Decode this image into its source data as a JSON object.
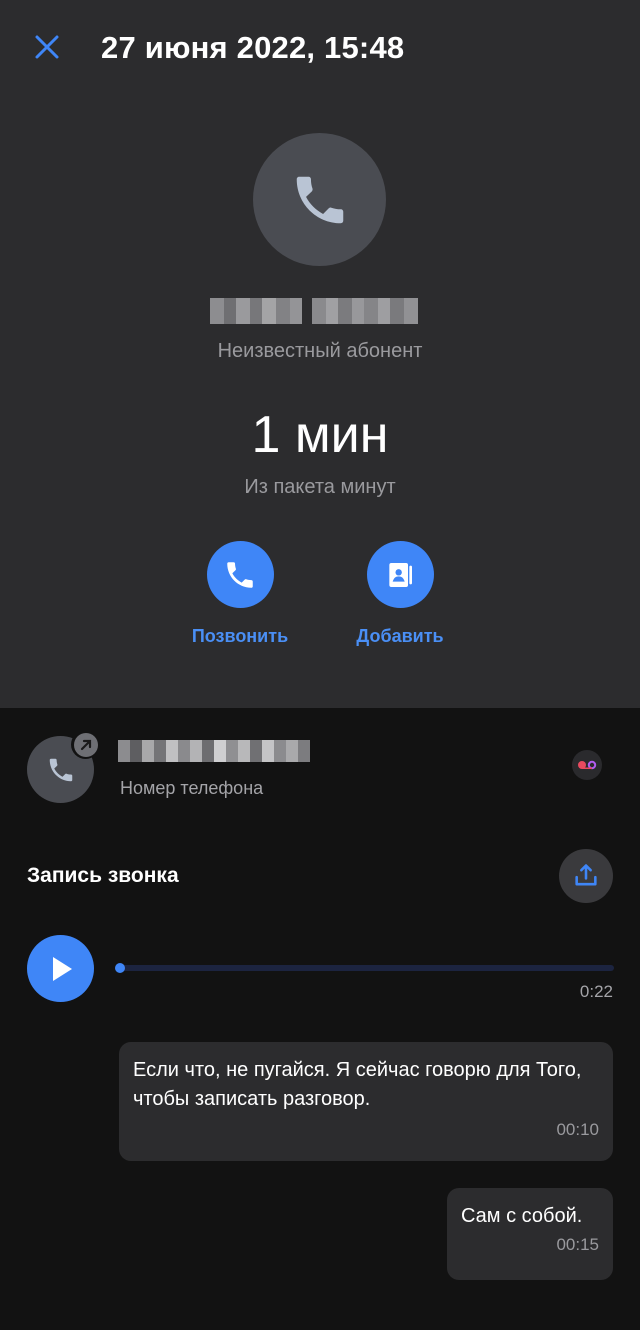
{
  "header": {
    "title": "27 июня 2022, 15:48",
    "close_icon": "close-icon"
  },
  "caller": {
    "status": "Неизвестный абонент",
    "duration": "1 мин",
    "duration_note": "Из пакета минут"
  },
  "actions": [
    {
      "label": "Позвонить",
      "icon": "phone-icon"
    },
    {
      "label": "Добавить",
      "icon": "contact-card-icon"
    }
  ],
  "contact": {
    "label": "Номер телефона"
  },
  "recording": {
    "title": "Запись звонка",
    "total_time": "0:22",
    "progress": 0.0
  },
  "transcript": [
    {
      "text": "Если что, не пугайся. Я сейчас говорю для Того, чтобы записать разговор.",
      "time": "00:10"
    },
    {
      "text": "Сам с собой.",
      "time": "00:15"
    }
  ],
  "colors": {
    "accent": "#3f86f7",
    "top_bg": "#2c2c2e",
    "bottom_bg": "#121212"
  }
}
